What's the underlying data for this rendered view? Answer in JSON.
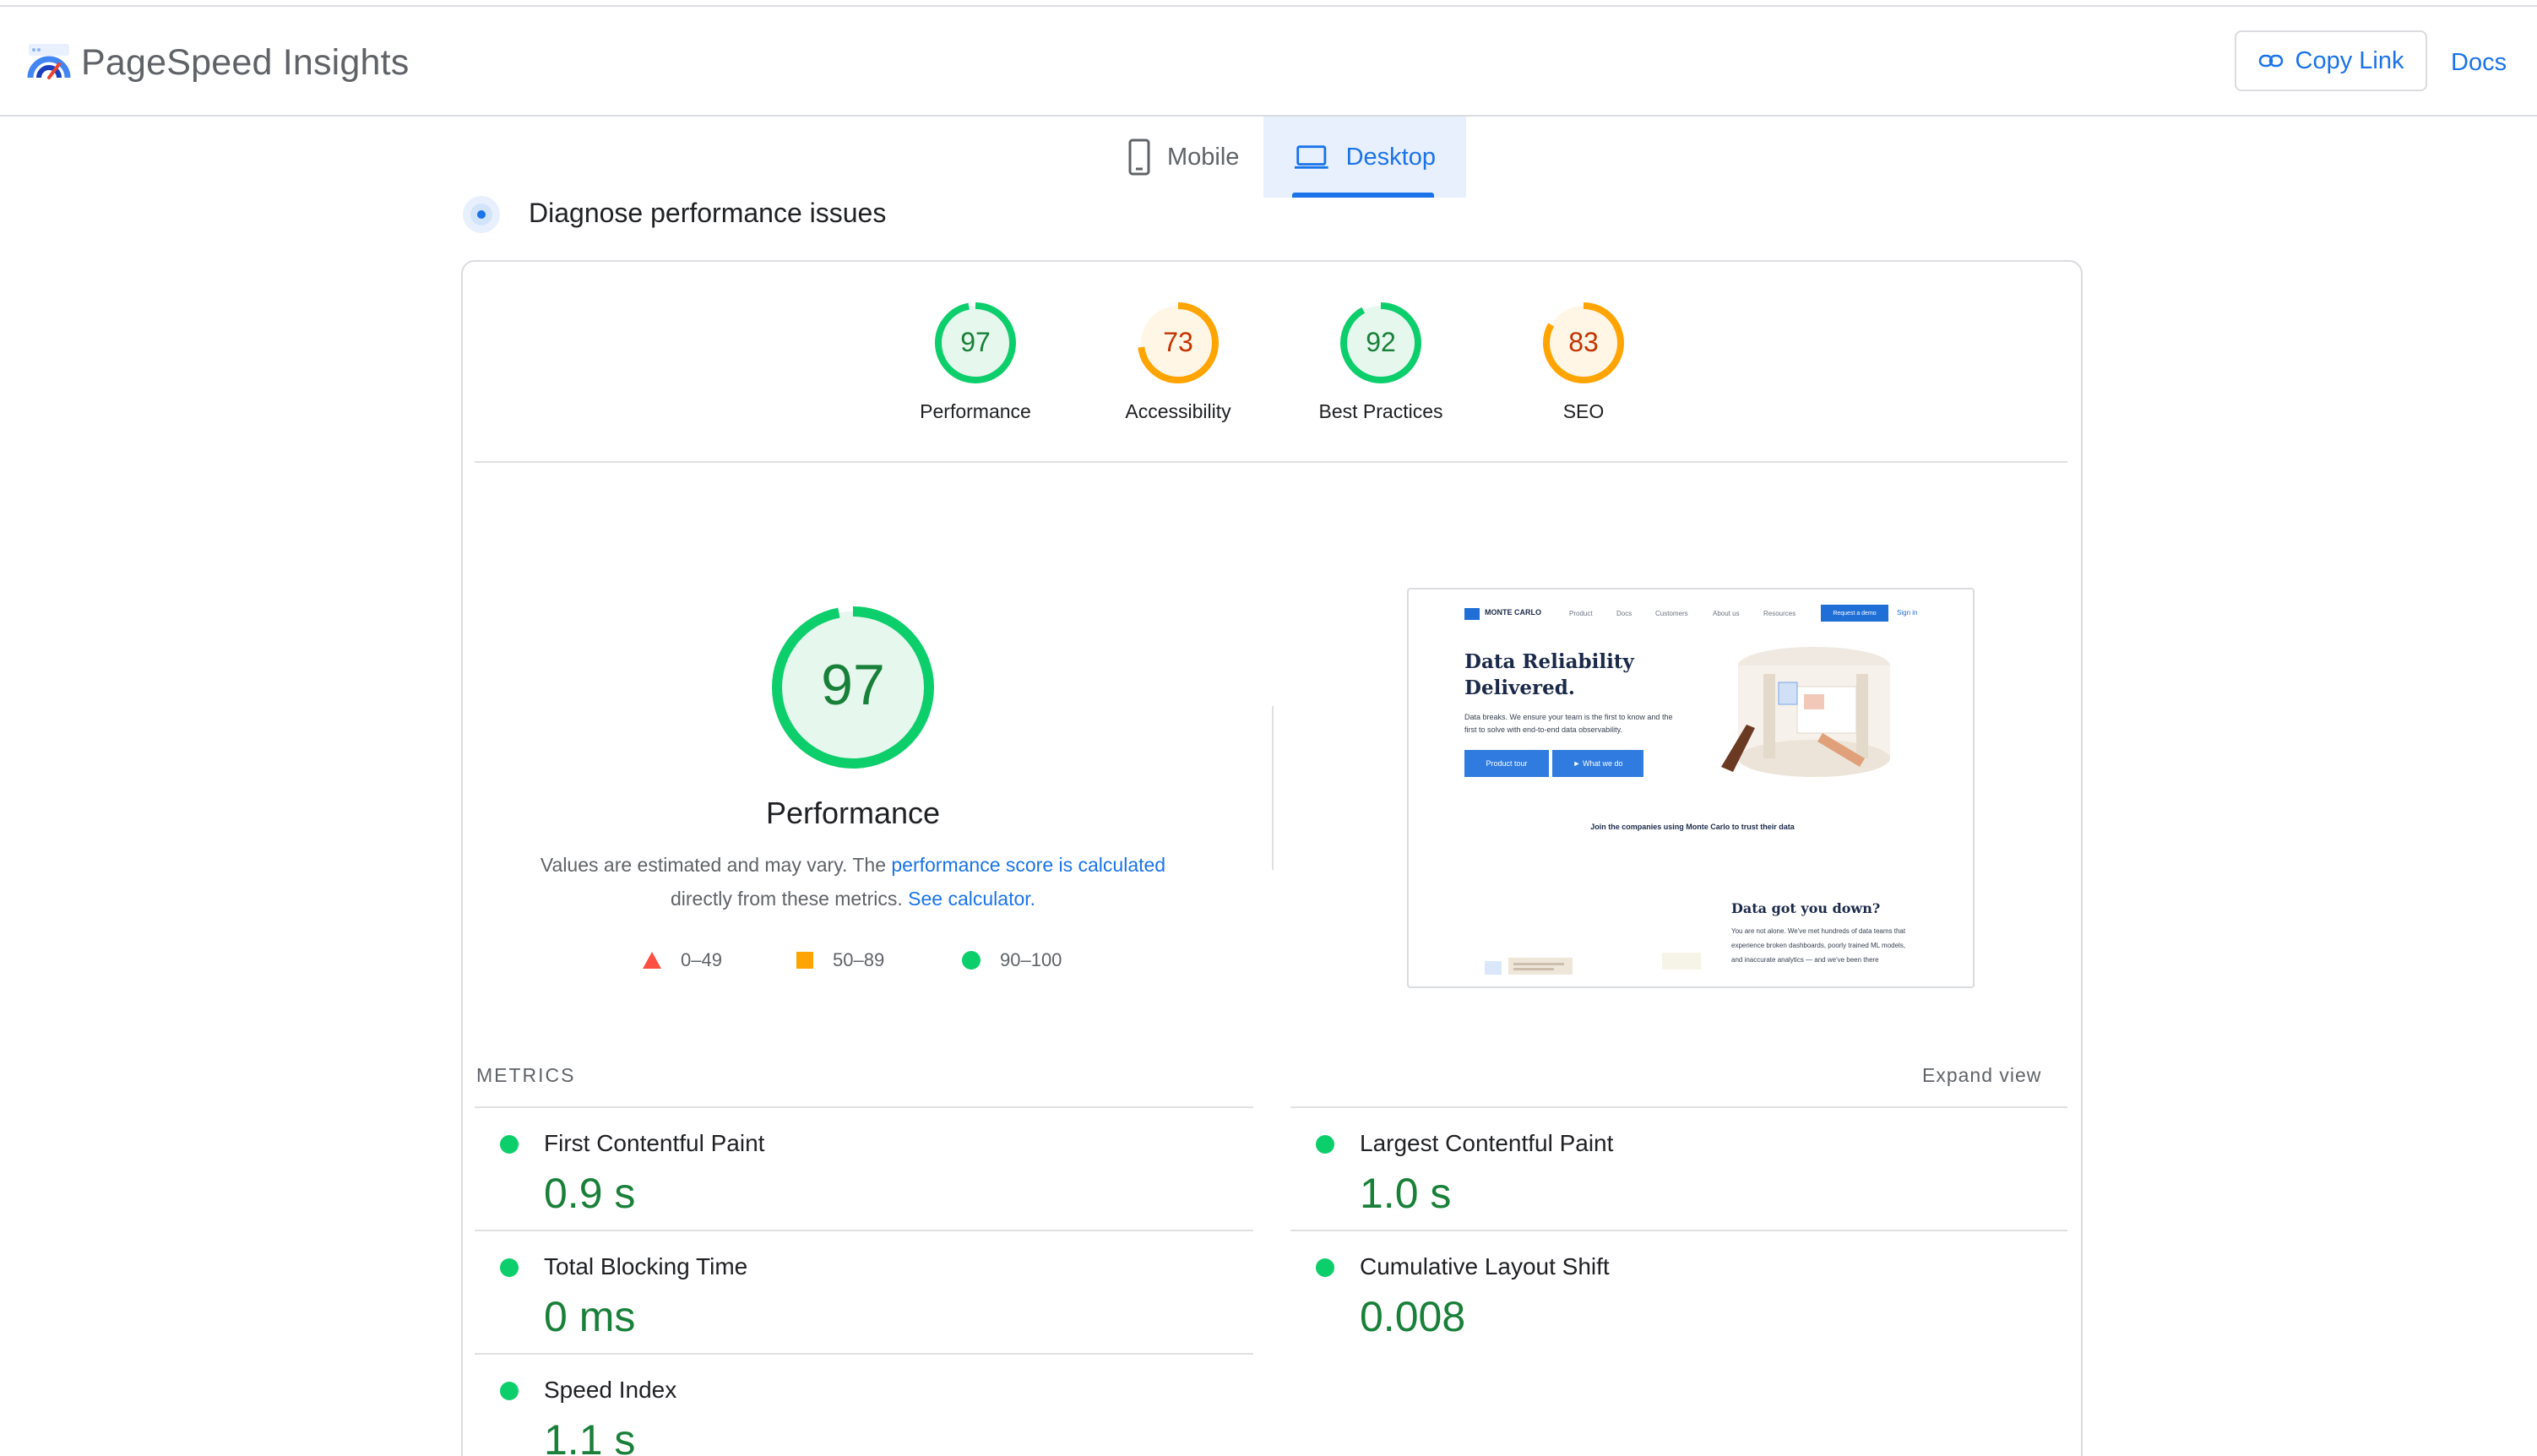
{
  "header": {
    "app_title": "PageSpeed Insights",
    "copy_link_label": "Copy Link",
    "docs_label": "Docs"
  },
  "tabs": [
    {
      "label": "Mobile",
      "icon": "phone-icon",
      "selected": false
    },
    {
      "label": "Desktop",
      "icon": "laptop-icon",
      "selected": true
    }
  ],
  "section": {
    "title": "Diagnose performance issues"
  },
  "categories": [
    {
      "label": "Performance",
      "score": "97",
      "status": "pass"
    },
    {
      "label": "Accessibility",
      "score": "73",
      "status": "average"
    },
    {
      "label": "Best Practices",
      "score": "92",
      "status": "pass"
    },
    {
      "label": "SEO",
      "score": "83",
      "status": "average"
    }
  ],
  "performance": {
    "score": "97",
    "title": "Performance",
    "note_prefix": "Values are estimated and may vary. The ",
    "note_link1": "performance score is calculated",
    "note_middle": " directly from these metrics. ",
    "note_link2": "See calculator."
  },
  "legend": [
    {
      "range": "0–49",
      "shape": "triangle",
      "color": "#ff4e42"
    },
    {
      "range": "50–89",
      "shape": "square",
      "color": "#ffa400"
    },
    {
      "range": "90–100",
      "shape": "circle",
      "color": "#0cce6b"
    }
  ],
  "thumbnail": {
    "brand": "MONTE CARLO",
    "nav": [
      "Product",
      "Docs",
      "Customers",
      "About us",
      "Resources"
    ],
    "cta": "Request a demo",
    "signin": "Sign in",
    "hero": "Data Reliability Delivered.",
    "sub": "Data breaks. We ensure your team is the first to know and the first to solve with end-to-end data observability.",
    "btn_primary": "Product tour",
    "btn_secondary": "► What we do",
    "join_text": "Join the companies using Monte Carlo to trust their data",
    "h2": "Data got you down?",
    "p2": "You are not alone. We've met hundreds of data teams that experience broken dashboards, poorly trained ML models, and inaccurate analytics — and we've been there"
  },
  "metrics": {
    "label": "METRICS",
    "expand_label": "Expand view",
    "items": [
      {
        "name": "First Contentful Paint",
        "value": "0.9 s"
      },
      {
        "name": "Largest Contentful Paint",
        "value": "1.0 s"
      },
      {
        "name": "Total Blocking Time",
        "value": "0 ms"
      },
      {
        "name": "Cumulative Layout Shift",
        "value": "0.008"
      },
      {
        "name": "Speed Index",
        "value": "1.1 s"
      }
    ]
  },
  "colors": {
    "pass": "#0cce6b",
    "pass_text": "#188038",
    "average": "#ffa400",
    "average_text": "#c33300",
    "accent": "#1a73e8"
  }
}
